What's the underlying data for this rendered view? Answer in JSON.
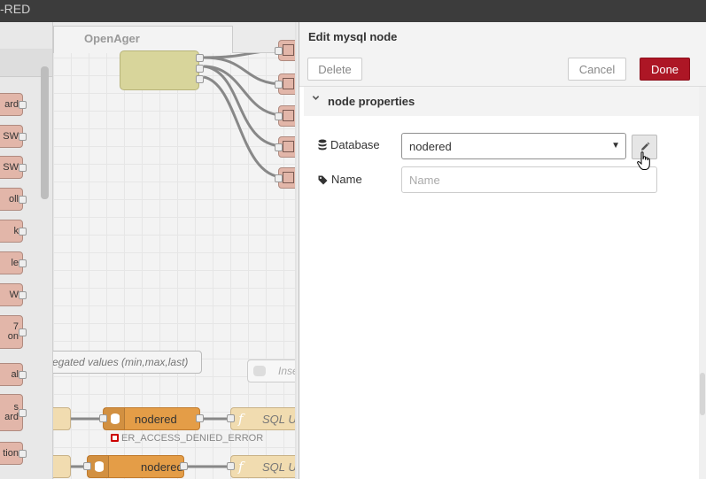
{
  "header": {
    "title": "-RED"
  },
  "workspace": {
    "tab_label": "OpenAger",
    "comment_text": "egated values (min,max,last)",
    "inject_label": "Inse",
    "db_nodes": [
      {
        "label": "nodered"
      },
      {
        "label": "nodered"
      }
    ],
    "sql_nodes": [
      {
        "label": "SQL U"
      },
      {
        "label": "SQL U"
      }
    ],
    "error_text": "ER_ACCESS_DENIED_ERROR"
  },
  "palette": {
    "items": [
      {
        "label": "ard"
      },
      {
        "label": "SW"
      },
      {
        "label": "SW"
      },
      {
        "label": "oll"
      },
      {
        "label": "k"
      },
      {
        "label": "le"
      },
      {
        "label": "W"
      },
      {
        "label": "7\non"
      },
      {
        "label": "al"
      },
      {
        "label": "s\nard"
      },
      {
        "label": "tion"
      }
    ]
  },
  "tray": {
    "title": "Edit mysql node",
    "delete_label": "Delete",
    "cancel_label": "Cancel",
    "done_label": "Done",
    "section_label": "node properties",
    "database_label": "Database",
    "database_value": "nodered",
    "name_label": "Name",
    "name_placeholder": "Name",
    "name_value": ""
  },
  "colors": {
    "done_button": "#ad1625",
    "header_bar": "#3c3c3c",
    "db_node": "#e49d47",
    "function_node": "#d8d59b",
    "chart_node": "#e2b6a9"
  }
}
